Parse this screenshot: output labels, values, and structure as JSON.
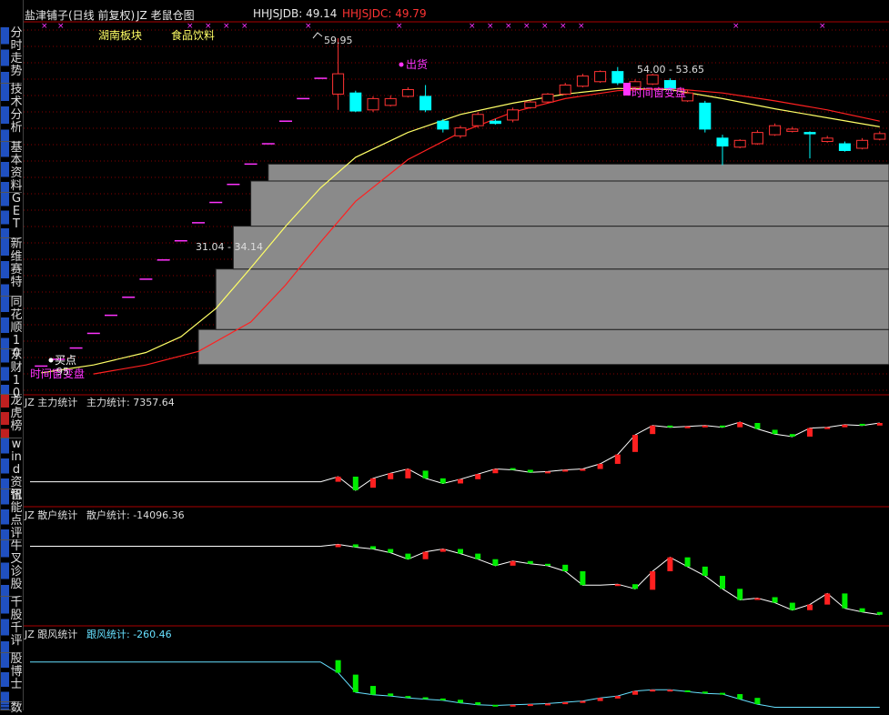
{
  "header": {
    "stock": "盐津铺子(日线 前复权)",
    "formula": "JZ 老鼠仓图",
    "db_label": "HHJSJDB: 49.14",
    "dc_label": "HHJSJDC: 49.79",
    "tag1": "湖南板块",
    "tag2": "食品饮料"
  },
  "sidebar": [
    {
      "label": "分时走势"
    },
    {
      "label": "技术分析"
    },
    {
      "label": "基本资料"
    },
    {
      "label": "GET"
    },
    {
      "label": "新维赛特"
    },
    {
      "label": "同花顺10"
    },
    {
      "label": "东财10"
    },
    {
      "label": "龙虎榜"
    },
    {
      "label": "wind资讯"
    },
    {
      "label": "智能点评"
    },
    {
      "label": "牛叉诊股"
    },
    {
      "label": "千股千评"
    },
    {
      "label": "股博士"
    },
    {
      "label": "数"
    }
  ],
  "colors": {
    "up": "#ff3333",
    "down": "#00ffff",
    "ma1": "#ffff66",
    "ma2": "#ff2020",
    "magenta": "#ff33ff",
    "zone": "#8a8a8a",
    "grid": "#880000",
    "bar_up": "#ff2020",
    "bar_down": "#00ee00"
  },
  "chart_data": [
    {
      "type": "candlestick",
      "title": "JZ 老鼠仓图",
      "ylim": [
        29,
        61
      ],
      "annotations": {
        "high": "59.95",
        "zone_low": "31.04 - 34.14",
        "zone_high": "54.00 - 53.65",
        "buy": "买点",
        "sell": "出货",
        "left_note": "时间窗变盘",
        "right_note": "时间窗变盘",
        "left_value": "95"
      },
      "dashes": [
        {
          "x": 2,
          "y": 30.9
        },
        {
          "x": 4,
          "y": 31.5
        },
        {
          "x": 6,
          "y": 32.5
        },
        {
          "x": 8,
          "y": 33.8
        },
        {
          "x": 10,
          "y": 35.4
        },
        {
          "x": 12,
          "y": 37.0
        },
        {
          "x": 14,
          "y": 38.6
        },
        {
          "x": 16,
          "y": 40.3
        },
        {
          "x": 18,
          "y": 42.0
        },
        {
          "x": 20,
          "y": 43.6
        },
        {
          "x": 22,
          "y": 45.4
        },
        {
          "x": 24,
          "y": 47.0
        },
        {
          "x": 26,
          "y": 48.8
        },
        {
          "x": 28,
          "y": 50.6
        },
        {
          "x": 30,
          "y": 52.6
        },
        {
          "x": 32,
          "y": 54.6
        },
        {
          "x": 34,
          "y": 56.4
        }
      ],
      "candles": [
        {
          "x": 36,
          "o": 55.0,
          "c": 56.8,
          "h": 59.95,
          "l": 53.6
        },
        {
          "x": 38,
          "o": 55.1,
          "c": 53.5,
          "h": 55.3,
          "l": 53.4
        },
        {
          "x": 40,
          "o": 53.6,
          "c": 54.6,
          "h": 54.8,
          "l": 53.4
        },
        {
          "x": 42,
          "o": 54.0,
          "c": 54.6,
          "h": 54.9,
          "l": 53.9
        },
        {
          "x": 44,
          "o": 54.8,
          "c": 55.4,
          "h": 55.6,
          "l": 54.7
        },
        {
          "x": 46,
          "o": 54.8,
          "c": 53.6,
          "h": 55.8,
          "l": 53.4
        },
        {
          "x": 48,
          "o": 52.6,
          "c": 51.9,
          "h": 52.8,
          "l": 51.6
        },
        {
          "x": 50,
          "o": 51.3,
          "c": 52.0,
          "h": 52.2,
          "l": 51.1
        },
        {
          "x": 52,
          "o": 52.2,
          "c": 53.2,
          "h": 53.4,
          "l": 52.0
        },
        {
          "x": 54,
          "o": 52.6,
          "c": 52.4,
          "h": 52.8,
          "l": 52.3
        },
        {
          "x": 56,
          "o": 52.7,
          "c": 53.6,
          "h": 53.8,
          "l": 52.5
        },
        {
          "x": 58,
          "o": 53.8,
          "c": 54.3,
          "h": 54.4,
          "l": 53.7
        },
        {
          "x": 60,
          "o": 54.3,
          "c": 55.0,
          "h": 55.1,
          "l": 54.2
        },
        {
          "x": 62,
          "o": 55.0,
          "c": 55.8,
          "h": 56.0,
          "l": 54.9
        },
        {
          "x": 64,
          "o": 55.7,
          "c": 56.6,
          "h": 56.8,
          "l": 55.6
        },
        {
          "x": 66,
          "o": 56.1,
          "c": 57.0,
          "h": 57.1,
          "l": 56.0
        },
        {
          "x": 68,
          "o": 57.0,
          "c": 56.0,
          "h": 57.4,
          "l": 55.8
        },
        {
          "x": 70,
          "o": 55.6,
          "c": 56.1,
          "h": 56.3,
          "l": 55.5
        },
        {
          "x": 72,
          "o": 55.9,
          "c": 56.7,
          "h": 56.8,
          "l": 55.8
        },
        {
          "x": 74,
          "o": 56.2,
          "c": 55.5,
          "h": 56.4,
          "l": 55.3
        },
        {
          "x": 76,
          "o": 54.4,
          "c": 55.1,
          "h": 55.4,
          "l": 54.3
        },
        {
          "x": 78,
          "o": 54.2,
          "c": 51.9,
          "h": 54.4,
          "l": 51.6
        },
        {
          "x": 80,
          "o": 51.1,
          "c": 50.4,
          "h": 51.4,
          "l": 48.7
        },
        {
          "x": 82,
          "o": 50.3,
          "c": 50.9,
          "h": 51.0,
          "l": 50.2
        },
        {
          "x": 84,
          "o": 50.6,
          "c": 51.6,
          "h": 51.8,
          "l": 50.5
        },
        {
          "x": 86,
          "o": 51.4,
          "c": 52.2,
          "h": 52.4,
          "l": 51.3
        },
        {
          "x": 88,
          "o": 51.7,
          "c": 51.9,
          "h": 52.1,
          "l": 51.6
        },
        {
          "x": 90,
          "o": 51.6,
          "c": 51.5,
          "h": 51.7,
          "l": 49.3
        },
        {
          "x": 92,
          "o": 50.8,
          "c": 51.1,
          "h": 51.3,
          "l": 50.7
        },
        {
          "x": 94,
          "o": 50.6,
          "c": 50.0,
          "h": 50.8,
          "l": 49.9
        },
        {
          "x": 96,
          "o": 50.2,
          "c": 50.9,
          "h": 51.1,
          "l": 50.1
        },
        {
          "x": 98,
          "o": 51.0,
          "c": 51.5,
          "h": 51.7,
          "l": 50.9
        }
      ],
      "ma1": [
        [
          2,
          30.3
        ],
        [
          8,
          31.0
        ],
        [
          14,
          32.1
        ],
        [
          18,
          33.5
        ],
        [
          22,
          36.0
        ],
        [
          26,
          39.6
        ],
        [
          30,
          43.3
        ],
        [
          34,
          46.7
        ],
        [
          38,
          49.4
        ],
        [
          44,
          51.6
        ],
        [
          50,
          53.2
        ],
        [
          56,
          54.2
        ],
        [
          62,
          55.0
        ],
        [
          68,
          55.5
        ],
        [
          74,
          55.4
        ],
        [
          80,
          54.6
        ],
        [
          86,
          53.7
        ],
        [
          92,
          52.9
        ],
        [
          98,
          52.1
        ]
      ],
      "ma2": [
        [
          8,
          30.2
        ],
        [
          14,
          31.0
        ],
        [
          20,
          32.2
        ],
        [
          26,
          34.8
        ],
        [
          30,
          38.1
        ],
        [
          34,
          41.9
        ],
        [
          38,
          45.5
        ],
        [
          44,
          49.2
        ],
        [
          50,
          51.6
        ],
        [
          56,
          53.4
        ],
        [
          62,
          54.6
        ],
        [
          68,
          55.3
        ],
        [
          74,
          55.5
        ],
        [
          80,
          55.1
        ],
        [
          86,
          54.4
        ],
        [
          92,
          53.6
        ],
        [
          98,
          52.6
        ]
      ],
      "zones": [
        {
          "x0": 20,
          "low": 31.04,
          "high": 34.14
        },
        {
          "x0": 22,
          "low": 34.14,
          "high": 39.5
        },
        {
          "x0": 24,
          "low": 39.5,
          "high": 43.3
        },
        {
          "x0": 26,
          "low": 43.3,
          "high": 47.3
        },
        {
          "x0": 28,
          "low": 47.3,
          "high": 48.8
        }
      ]
    },
    {
      "type": "bar-line",
      "title": "JZ 主力统计",
      "label": "主力统计: 7357.64",
      "ylim": [
        -5,
        105
      ],
      "flat": 20,
      "x": [
        34,
        36,
        38,
        40,
        42,
        44,
        46,
        48,
        50,
        52,
        54,
        56,
        58,
        60,
        62,
        64,
        66,
        68,
        70,
        72,
        74,
        76,
        78,
        80,
        82,
        84,
        86,
        88,
        90,
        92,
        94,
        96,
        98
      ],
      "values": [
        20,
        26,
        10,
        24,
        30,
        35,
        24,
        18,
        23,
        29,
        35,
        34,
        31,
        32,
        34,
        35,
        41,
        52,
        75,
        86,
        84,
        85,
        86,
        84,
        90,
        82,
        76,
        73,
        83,
        84,
        87,
        86,
        89
      ],
      "deltas": [
        0,
        6,
        -16,
        11,
        7,
        11,
        -9,
        -6,
        5,
        6,
        5,
        -2,
        -3,
        1,
        2,
        2,
        6,
        11,
        20,
        10,
        -2,
        1,
        1,
        -2,
        6,
        -7,
        -5,
        -3,
        10,
        1,
        3,
        -2,
        3
      ]
    },
    {
      "type": "bar-line",
      "title": "JZ 散户统计",
      "label": "散户统计: -14096.36",
      "ylim": [
        -5,
        105
      ],
      "flat": 79,
      "x": [
        34,
        36,
        38,
        40,
        42,
        44,
        46,
        48,
        50,
        52,
        54,
        56,
        58,
        60,
        62,
        64,
        66,
        68,
        70,
        72,
        74,
        76,
        78,
        80,
        82,
        84,
        86,
        88,
        90,
        92,
        94,
        96,
        98
      ],
      "values": [
        79,
        81,
        78,
        76,
        72,
        65,
        73,
        76,
        71,
        65,
        58,
        63,
        60,
        58,
        52,
        37,
        37,
        38,
        33,
        52,
        67,
        57,
        47,
        33,
        21,
        23,
        18,
        10,
        16,
        28,
        12,
        8,
        5
      ],
      "deltas": [
        0,
        3,
        -3,
        -3,
        -4,
        -6,
        8,
        3,
        -5,
        -6,
        -7,
        5,
        -3,
        -2,
        -7,
        -15,
        0,
        1,
        -5,
        20,
        15,
        -10,
        -10,
        -14,
        -12,
        2,
        -6,
        -8,
        6,
        12,
        -16,
        -4,
        -3
      ]
    },
    {
      "type": "bar-line",
      "title": "JZ 跟风统计",
      "label": "跟风统计: -260.46",
      "ylim": [
        -5,
        105
      ],
      "flat": 72,
      "x": [
        34,
        36,
        38,
        40,
        42,
        44,
        46,
        48,
        50,
        52,
        54,
        56,
        58,
        60,
        62,
        64,
        66,
        68,
        70,
        72,
        74,
        76,
        78,
        80,
        82,
        84,
        86,
        88,
        90,
        92,
        94,
        96,
        98
      ],
      "values": [
        72,
        55,
        24,
        20,
        18,
        15,
        13,
        11,
        7,
        4,
        3,
        4,
        5,
        6,
        8,
        10,
        15,
        18,
        26,
        28,
        28,
        25,
        22,
        21,
        13,
        5,
        0,
        0,
        0,
        0,
        0,
        0,
        0
      ],
      "deltas": [
        0,
        -20,
        -28,
        -14,
        -4,
        -3,
        -3,
        -3,
        -5,
        -4,
        -1,
        1,
        2,
        1,
        3,
        3,
        5,
        4,
        6,
        2,
        1,
        -2,
        -3,
        -2,
        -8,
        -10,
        0,
        0,
        0,
        0,
        0,
        0,
        0
      ]
    }
  ]
}
